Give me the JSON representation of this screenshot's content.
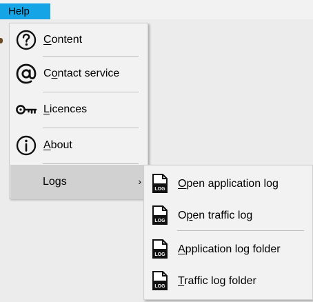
{
  "menubar": {
    "help_label": "Help"
  },
  "help_menu": {
    "items": [
      {
        "pre": "",
        "accel": "C",
        "post": "ontent",
        "icon": "question-circle-icon"
      },
      {
        "pre": "C",
        "accel": "o",
        "post": "ntact service",
        "icon": "at-sign-icon"
      },
      {
        "pre": "",
        "accel": "L",
        "post": "icences",
        "icon": "key-icon"
      },
      {
        "pre": "",
        "accel": "A",
        "post": "bout",
        "icon": "info-circle-icon"
      },
      {
        "pre": "Lo",
        "accel": "g",
        "post": "s",
        "icon": "",
        "submenu_arrow": "›"
      }
    ]
  },
  "logs_submenu": {
    "items": [
      {
        "pre": "",
        "accel": "O",
        "post": "pen application log",
        "icon": "log-file-icon",
        "icon_text": "LOG"
      },
      {
        "pre": "O",
        "accel": "p",
        "post": "en traffic log",
        "icon": "log-file-icon",
        "icon_text": "LOG"
      },
      {
        "pre": "",
        "accel": "A",
        "post": "pplication log folder",
        "icon": "log-file-icon",
        "icon_text": "LOG"
      },
      {
        "pre": "",
        "accel": "T",
        "post": "raffic log folder",
        "icon": "log-file-icon",
        "icon_text": "LOG"
      }
    ]
  },
  "colors": {
    "menubar_highlight": "#15a4e5",
    "menu_background": "#f2f2f2",
    "hover_background": "#d1d1d1"
  }
}
